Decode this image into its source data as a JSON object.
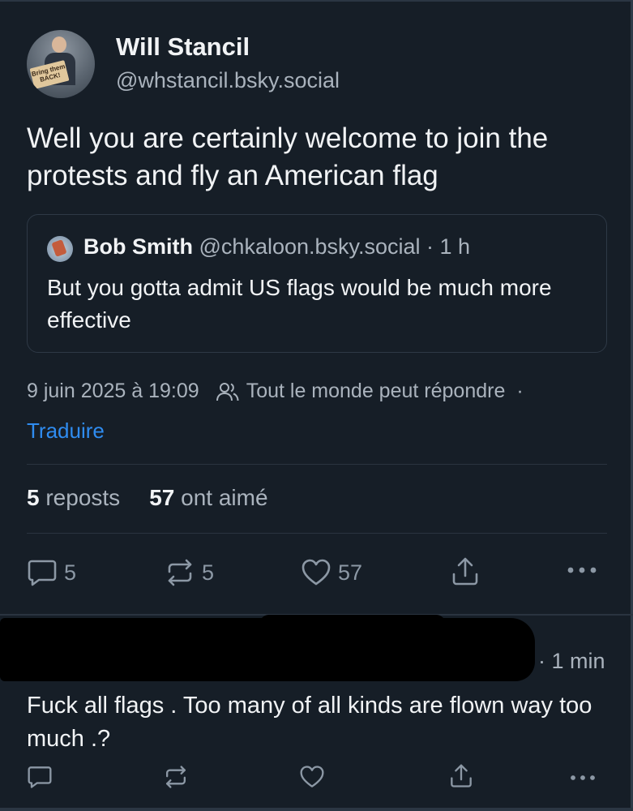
{
  "post": {
    "author_name": "Will Stancil",
    "author_handle": "@whstancil.bsky.social",
    "avatar_sign_text": "Bring them BACK!",
    "text": "Well you are certainly welcome to join the protests and fly an American flag",
    "quote": {
      "author_name": "Bob Smith",
      "author_handle": "@chkaloon.bsky.social · 1 h",
      "text": "But you gotta admit US flags would be much more effective"
    },
    "timestamp": "9 juin 2025 à 19:09",
    "reply_setting": "Tout le monde peut répondre",
    "meta_separator": "·",
    "translate_label": "Traduire",
    "reposts_count": "5",
    "reposts_label": "reposts",
    "likes_count": "57",
    "likes_label": "ont aimé",
    "actions": {
      "reply_count": "5",
      "repost_count": "5",
      "like_count": "57"
    }
  },
  "reply": {
    "time": "· 1 min",
    "text": "Fuck all flags . Too many of all kinds are flown way too much .?"
  },
  "colors": {
    "background": "#161e27",
    "text": "#f1f3f5",
    "muted": "#aab3bd",
    "link": "#2f8cf0",
    "icon": "#8c98a5"
  }
}
